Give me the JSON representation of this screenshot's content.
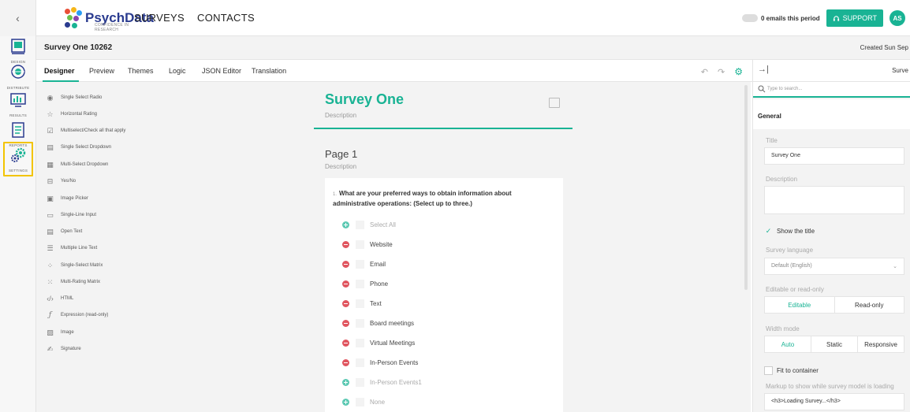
{
  "topbar": {
    "collapse_glyph": "‹",
    "logo_text": "PsychData",
    "logo_sub": "CONFIDENCE IN RESEARCH",
    "nav": [
      "SURVEYS",
      "CONTACTS"
    ],
    "email_status": "0 emails this period",
    "support_label": "SUPPORT",
    "avatar_initials": "AS"
  },
  "leftnav": {
    "items": [
      {
        "label": "DESIGN",
        "icon": "design-icon"
      },
      {
        "label": "DISTRIBUTE",
        "icon": "distribute-icon"
      },
      {
        "label": "RESULTS",
        "icon": "results-icon"
      },
      {
        "label": "REPORTS",
        "icon": "reports-icon"
      },
      {
        "label": "SETTINGS",
        "icon": "settings-icon"
      }
    ]
  },
  "titlebar": {
    "survey_name": "Survey One 10262",
    "created": "Created Sun Sep"
  },
  "tabs": [
    "Designer",
    "Preview",
    "Themes",
    "Logic",
    "JSON Editor",
    "Translation"
  ],
  "toolbox": [
    {
      "label": "Single Select Radio",
      "icon": "radio-icon"
    },
    {
      "label": "Horizontal Rating",
      "icon": "star-icon"
    },
    {
      "label": "Multiselect/Check all that apply",
      "icon": "checkbox-icon"
    },
    {
      "label": "Single Select Dropdown",
      "icon": "dropdown-icon"
    },
    {
      "label": "Multi-Select Dropdown",
      "icon": "multi-dropdown-icon"
    },
    {
      "label": "Yes/No",
      "icon": "toggle-icon"
    },
    {
      "label": "Image Picker",
      "icon": "image-picker-icon"
    },
    {
      "label": "Single-Line Input",
      "icon": "text-input-icon"
    },
    {
      "label": "Open Text",
      "icon": "open-text-icon"
    },
    {
      "label": "Multiple Line Text",
      "icon": "multiline-icon"
    },
    {
      "label": "Single-Select Matrix",
      "icon": "matrix-icon"
    },
    {
      "label": "Multi-Rating Matrix",
      "icon": "rating-matrix-icon"
    },
    {
      "label": "HTML",
      "icon": "html-icon"
    },
    {
      "label": "Expression (read-only)",
      "icon": "expression-icon"
    },
    {
      "label": "Image",
      "icon": "image-icon"
    },
    {
      "label": "Signature",
      "icon": "signature-icon"
    }
  ],
  "canvas": {
    "survey_title": "Survey One",
    "survey_description": "Description",
    "page_title": "Page 1",
    "page_description": "Description",
    "question": {
      "number": "1.",
      "title": "What are your preferred ways to obtain information about administrative operations: (Select up to three.)",
      "choices": [
        {
          "label": "Select All",
          "sign": "plus",
          "muted": true
        },
        {
          "label": "Website",
          "sign": "minus",
          "muted": false
        },
        {
          "label": "Email",
          "sign": "minus",
          "muted": false
        },
        {
          "label": "Phone",
          "sign": "minus",
          "muted": false
        },
        {
          "label": "Text",
          "sign": "minus",
          "muted": false
        },
        {
          "label": "Board meetings",
          "sign": "minus",
          "muted": false
        },
        {
          "label": "Virtual Meetings",
          "sign": "minus",
          "muted": false
        },
        {
          "label": "In-Person Events",
          "sign": "minus",
          "muted": false
        },
        {
          "label": "In-Person Events1",
          "sign": "plus",
          "muted": true
        },
        {
          "label": "None",
          "sign": "plus",
          "muted": true
        }
      ]
    }
  },
  "props": {
    "head_object": "Surve",
    "search_placeholder": "Type to search...",
    "section": "General",
    "title_label": "Title",
    "title_value": "Survey One",
    "description_label": "Description",
    "description_value": "",
    "show_title_label": "Show the title",
    "show_title_checked": true,
    "language_label": "Survey language",
    "language_value": "Default (English)",
    "edit_mode_label": "Editable or read-only",
    "edit_mode_options": [
      "Editable",
      "Read-only"
    ],
    "edit_mode_selected": "Editable",
    "width_mode_label": "Width mode",
    "width_mode_options": [
      "Auto",
      "Static",
      "Responsive"
    ],
    "width_mode_selected": "Auto",
    "fit_label": "Fit to container",
    "loading_markup_label": "Markup to show while survey model is loading",
    "loading_markup_value": "<h3>Loading Survey...</h3>"
  },
  "colors": {
    "accent": "#19b394",
    "danger": "#e0555f",
    "logo": "#2a3b8f",
    "highlight": "#f2c400"
  }
}
